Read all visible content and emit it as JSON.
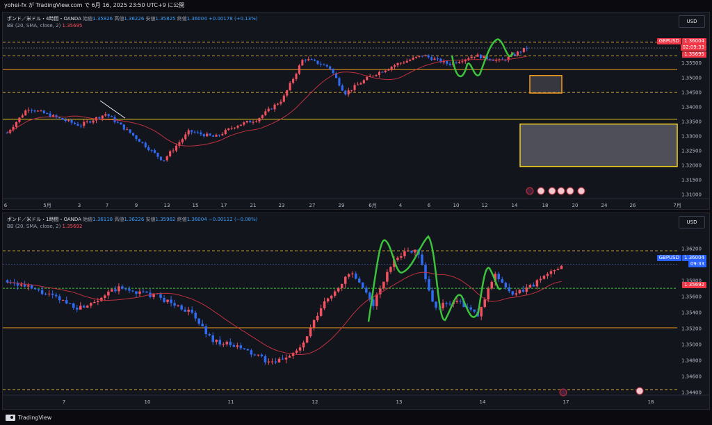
{
  "header": {
    "text": "yohei-fx が TradingView.com で 6月 16, 2025 23:50 UTC+9 に公開"
  },
  "footer": {
    "brand": "TradingView"
  },
  "pane_top": {
    "symbol_line": "ポンド／米ドル・4時間・OANDA",
    "open_label": "始値",
    "open": "1.35826",
    "high_label": "高値",
    "high": "1.36226",
    "low_label": "安値",
    "low": "1.35825",
    "close_label": "終値",
    "close": "1.36004",
    "change": "+0.00178 (+0.13%)",
    "bb_label": "BB (20, SMA, close, 2)",
    "bb_value": "1.35695",
    "currency": "USD",
    "symbol_tag": "GBPUSD",
    "price_tag": "1.36004",
    "countdown": "02:09:33",
    "bb_tag": "1.35695",
    "y_ticks": [
      "1.35500",
      "1.35000",
      "1.34500",
      "1.34000",
      "1.33500",
      "1.33000",
      "1.32500",
      "1.32000",
      "1.31500",
      "1.31000"
    ],
    "x_ticks": [
      "6",
      "5月",
      "3",
      "7",
      "9",
      "13",
      "15",
      "17",
      "21",
      "23",
      "27",
      "29",
      "6月",
      "4",
      "6",
      "10",
      "12",
      "14",
      "18",
      "20",
      "24",
      "26",
      "7月"
    ],
    "y_min": 1.3085,
    "y_max": 1.3655
  },
  "pane_bottom": {
    "symbol_line": "ポンド／米ドル・1時間・OANDA",
    "open_label": "始値",
    "open": "1.36118",
    "high_label": "高値",
    "high": "1.36226",
    "low_label": "安値",
    "low": "1.35962",
    "close_label": "終値",
    "close": "1.36004",
    "change": "−0.00112 (−0.08%)",
    "bb_label": "BB (20, SMA, close, 2)",
    "bb_value": "1.35692",
    "currency": "USD",
    "symbol_tag": "GBPUSD",
    "price_tag": "1.36004",
    "countdown": "09:33",
    "bb_tag": "1.35692",
    "y_ticks": [
      "1.36200",
      "1.35800",
      "1.35600",
      "1.35400",
      "1.35200",
      "1.35000",
      "1.34800",
      "1.34600",
      "1.34400"
    ],
    "x_ticks": [
      "7",
      "10",
      "11",
      "12",
      "13",
      "14",
      "17",
      "18"
    ],
    "y_min": 1.3436,
    "y_max": 1.3638
  },
  "colors": {
    "up": "#f2525f",
    "down": "#2f6bf2",
    "bb_line": "#c0313e",
    "orange": "#f29b1d",
    "yellow": "#f2d21d",
    "green": "#3cc33c",
    "dash": "#d0a93a",
    "price_red": "#f23645",
    "price_blue": "#2962ff"
  }
}
